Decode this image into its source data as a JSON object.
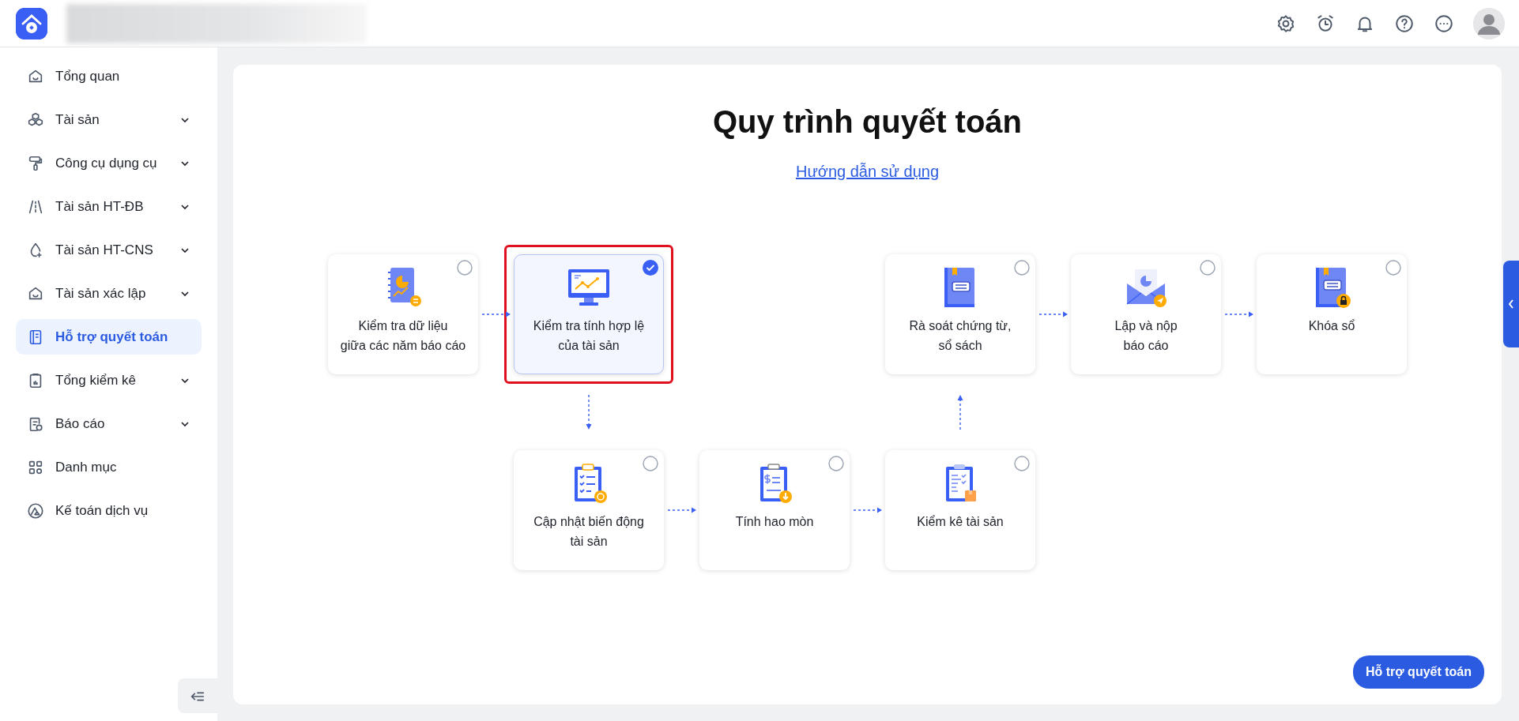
{
  "sidebar": {
    "items": [
      {
        "label": "Tổng quan",
        "selected": false
      },
      {
        "label": "Tài sản",
        "selected": false,
        "expanded": false
      },
      {
        "label": "Công cụ dụng cụ",
        "selected": false,
        "expanded": false
      },
      {
        "label": "Tài sản HT-ĐB",
        "selected": false,
        "expanded": false
      },
      {
        "label": "Tài sản HT-CNS",
        "selected": false,
        "expanded": false
      },
      {
        "label": "Tài sản xác lập",
        "selected": false,
        "expanded": false
      },
      {
        "label": "Hỗ trợ quyết toán",
        "selected": true
      },
      {
        "label": "Tổng kiểm kê",
        "selected": false,
        "expanded": false
      },
      {
        "label": "Báo cáo",
        "selected": false,
        "expanded": false
      },
      {
        "label": "Danh mục",
        "selected": false
      },
      {
        "label": "Kế toán dịch vụ",
        "selected": false
      }
    ]
  },
  "main": {
    "title": "Quy trình quyết toán",
    "guide_link": "Hướng dẫn sử dụng",
    "steps": [
      {
        "label": "Kiểm tra dữ liệu\ngiữa các năm báo cáo",
        "selected": false,
        "highlighted": false
      },
      {
        "label": "Kiểm tra tính hợp lệ\ncủa tài sản",
        "selected": true,
        "highlighted": true
      },
      {
        "label": "Rà soát chứng từ,\nsổ sách",
        "selected": false,
        "highlighted": false
      },
      {
        "label": "Lập và nộp\nbáo cáo",
        "selected": false,
        "highlighted": false
      },
      {
        "label": "Khóa sổ",
        "selected": false,
        "highlighted": false
      },
      {
        "label": "Cập nhật biến động\ntài sản",
        "selected": false,
        "highlighted": false
      },
      {
        "label": "Tính hao mòn",
        "selected": false,
        "highlighted": false
      },
      {
        "label": "Kiểm kê tài sản",
        "selected": false,
        "highlighted": false
      }
    ],
    "help_button": "Hỗ trợ quyết toán"
  }
}
